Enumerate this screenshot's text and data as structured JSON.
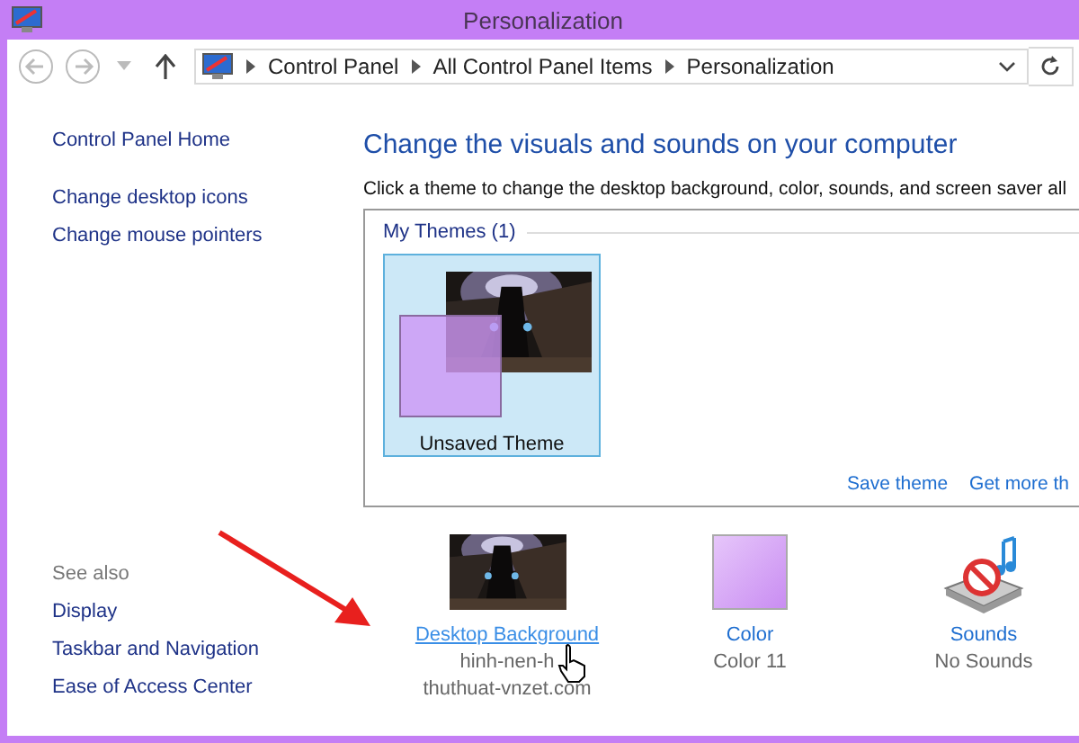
{
  "window": {
    "title": "Personalization"
  },
  "address_bar": {
    "breadcrumbs": [
      "Control Panel",
      "All Control Panel Items",
      "Personalization"
    ]
  },
  "sidebar": {
    "links": [
      "Control Panel Home",
      "Change desktop icons",
      "Change mouse pointers"
    ],
    "see_also": {
      "title": "See also",
      "links": [
        "Display",
        "Taskbar and Navigation",
        "Ease of Access Center"
      ]
    }
  },
  "main": {
    "heading": "Change the visuals and sounds on your computer",
    "description": "Click a theme to change the desktop background, color, sounds, and screen saver all",
    "theme_group": {
      "label": "My Themes (1)",
      "themes": [
        {
          "name": "Unsaved Theme",
          "selected": true
        }
      ]
    },
    "actions": [
      "Save theme",
      "Get more th"
    ],
    "settings": [
      {
        "kind": "background",
        "label": "Desktop Background",
        "hovered": true,
        "details": [
          "hinh-nen-h",
          "thuthuat-vnzet.com"
        ]
      },
      {
        "kind": "color",
        "label": "Color",
        "hovered": false,
        "details": [
          "Color 11"
        ]
      },
      {
        "kind": "sounds",
        "label": "Sounds",
        "hovered": false,
        "details": [
          "No Sounds"
        ]
      }
    ]
  }
}
